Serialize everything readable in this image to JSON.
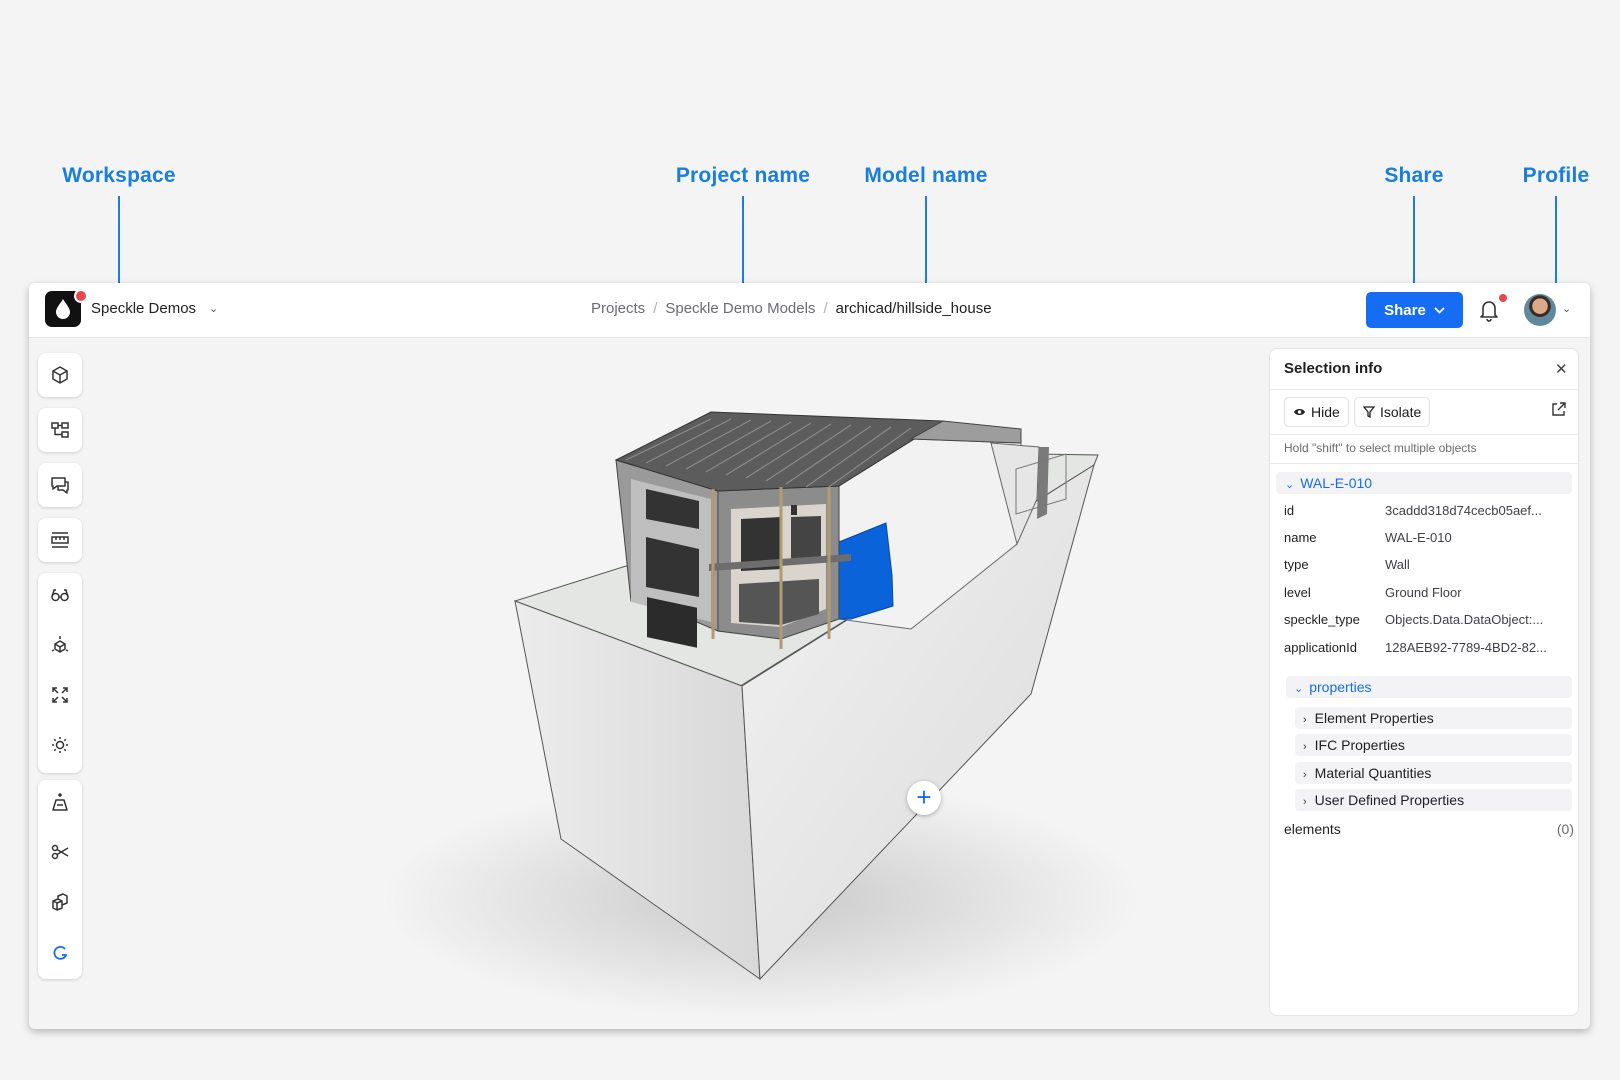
{
  "callouts": {
    "workspace": "Workspace",
    "project_name": "Project name",
    "model_name": "Model name",
    "share": "Share",
    "profile": "Profile"
  },
  "topbar": {
    "workspace_name": "Speckle Demos",
    "breadcrumb": {
      "projects": "Projects",
      "project": "Speckle Demo Models",
      "model": "archicad/hillside_house"
    },
    "share_label": "Share",
    "has_notifications": true
  },
  "toolbar": {
    "icons": [
      "cube-icon",
      "model-tree-icon",
      "comments-icon",
      "measure-icon",
      "glasses-icon",
      "explode-icon",
      "zoom-extents-icon",
      "sun-icon",
      "section-icon",
      "scissors-icon",
      "boxes-icon",
      "spinner-icon"
    ]
  },
  "selection": {
    "title": "Selection info",
    "hide_label": "Hide",
    "isolate_label": "Isolate",
    "hint": "Hold \"shift\" to select multiple objects",
    "object_name": "WAL-E-010",
    "props": [
      {
        "key": "id",
        "value": "3caddd318d74cecb05aef..."
      },
      {
        "key": "name",
        "value": "WAL-E-010"
      },
      {
        "key": "type",
        "value": "Wall"
      },
      {
        "key": "level",
        "value": "Ground Floor"
      },
      {
        "key": "speckle_type",
        "value": "Objects.Data.DataObject:..."
      },
      {
        "key": "applicationId",
        "value": "128AEB92-7789-4BD2-82..."
      }
    ],
    "properties_label": "properties",
    "sub_items": [
      "Element Properties",
      "IFC Properties",
      "Material Quantities",
      "User Defined Properties"
    ],
    "elements_label": "elements",
    "elements_count": "(0)"
  },
  "colors": {
    "accent": "#166df5",
    "callout": "#1a7de0",
    "selected_wall": "#0a63d9",
    "notification": "#e5484d"
  }
}
